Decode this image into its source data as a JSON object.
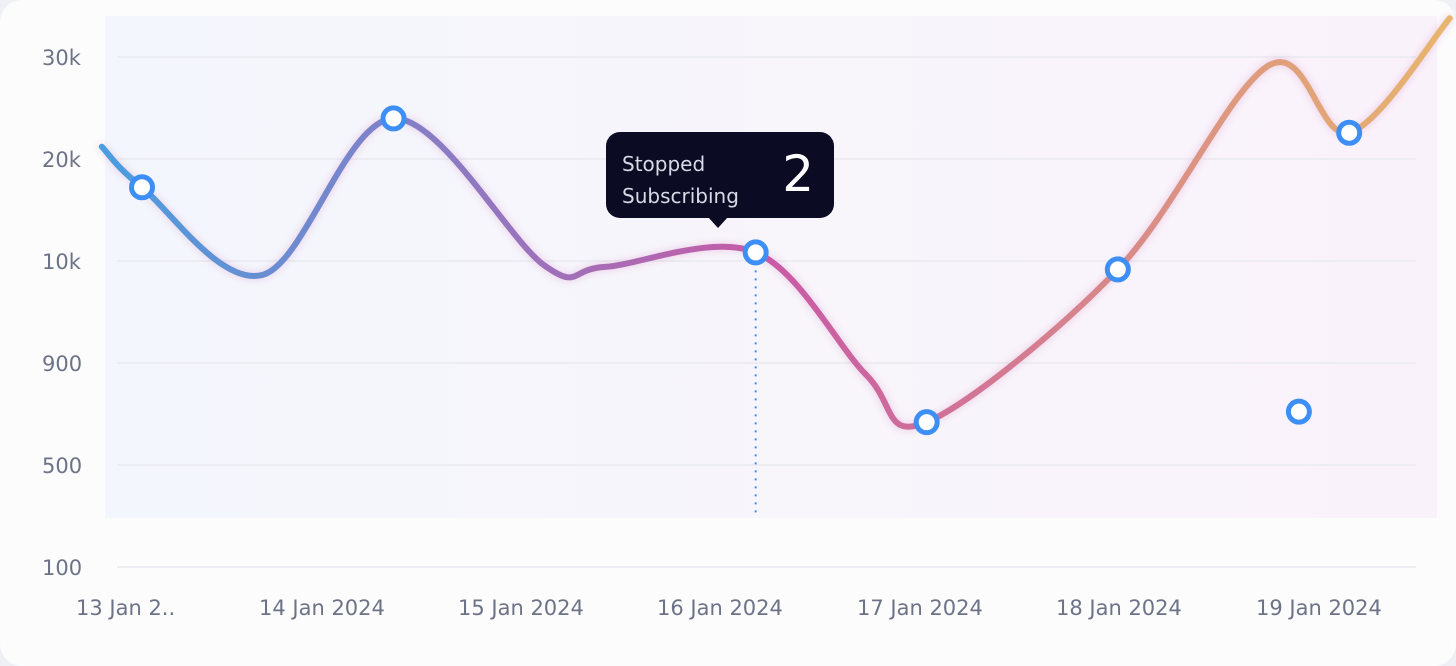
{
  "chart_data": {
    "type": "line",
    "title": "",
    "xlabel": "",
    "ylabel": "",
    "y_scale": "log",
    "y_ticks": [
      {
        "label": "30k",
        "value": 30000
      },
      {
        "label": "20k",
        "value": 20000
      },
      {
        "label": "10k",
        "value": 10000
      },
      {
        "label": "900",
        "value": 900
      },
      {
        "label": "500",
        "value": 500
      },
      {
        "label": "100",
        "value": 100
      }
    ],
    "x_ticks": [
      "13 Jan 2..",
      "14 Jan 2024",
      "15 Jan 2024",
      "16 Jan 2024",
      "17 Jan 2024",
      "18 Jan 2024",
      "19 Jan 2024"
    ],
    "grid": true,
    "legend": "none",
    "gradient_colors": [
      "#4a9ee0",
      "#c85aa6",
      "#e7b56d"
    ],
    "marker_color": "#3d8ff5",
    "series": [
      {
        "values": [
          21000,
          16500,
          7200,
          23500,
          9000,
          8700,
          10600,
          840,
          640,
          8200,
          29000,
          22200,
          35000
        ],
        "x": [
          -0.2,
          0.0,
          0.6,
          1.25,
          2.0,
          2.3,
          3.05,
          3.6,
          3.9,
          4.85,
          5.6,
          6.0,
          6.5
        ]
      }
    ],
    "markers": [
      {
        "x": 0.0,
        "value": 16500
      },
      {
        "x": 1.25,
        "value": 23500
      },
      {
        "x": 3.05,
        "value": 10600
      },
      {
        "x": 3.9,
        "value": 640
      },
      {
        "x": 4.85,
        "value": 8200
      },
      {
        "x": 5.75,
        "value": 680
      },
      {
        "x": 6.0,
        "value": 22200
      }
    ],
    "highlight": {
      "x": 3.05,
      "label": "Stopped Subscribing",
      "value": "2"
    }
  }
}
